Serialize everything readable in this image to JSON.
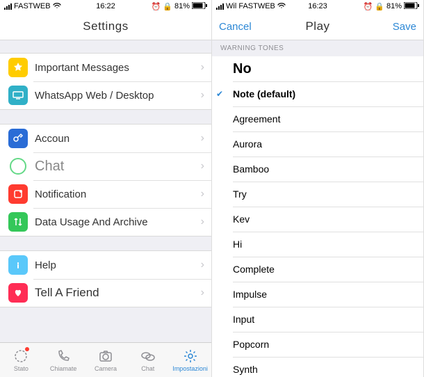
{
  "left": {
    "status": {
      "carrier": "FASTWEB",
      "time": "16:22",
      "battery": "81%"
    },
    "title": "Settings",
    "groups": [
      {
        "rows": [
          {
            "key": "important",
            "label": "Important Messages",
            "color": "#ffcc00"
          },
          {
            "key": "waweb",
            "label": "WhatsApp Web / Desktop",
            "color": "#30b0c7"
          }
        ]
      },
      {
        "rows": [
          {
            "key": "account",
            "label": "Accoun",
            "color": "#2a6cd6"
          },
          {
            "key": "chat",
            "label": "Chat",
            "color": "#64d987"
          },
          {
            "key": "notification",
            "label": "Notification",
            "color": "#ff3b30"
          },
          {
            "key": "data",
            "label": "Data Usage And Archive",
            "color": "#34c759"
          }
        ]
      },
      {
        "rows": [
          {
            "key": "help",
            "label": "Help",
            "color": "#5ac8fa"
          },
          {
            "key": "tell",
            "label": "Tell A Friend",
            "color": "#ff2d55"
          }
        ]
      }
    ],
    "tabs": [
      {
        "key": "stato",
        "label": "Stato"
      },
      {
        "key": "chiamate",
        "label": "Chiamate"
      },
      {
        "key": "camera",
        "label": "Camera"
      },
      {
        "key": "chat",
        "label": "Chat"
      },
      {
        "key": "impostazioni",
        "label": "Impostazioni"
      }
    ]
  },
  "right": {
    "status": {
      "carrier": "Wil FASTWEB",
      "time": "16:23",
      "battery": "81%"
    },
    "cancel": "Cancel",
    "title": "Play",
    "save": "Save",
    "section_header": "WARNING TONES",
    "tones": [
      {
        "key": "no",
        "label": "No",
        "big": true
      },
      {
        "key": "note",
        "label": "Note (default)",
        "selected": true
      },
      {
        "key": "agreement",
        "label": "Agreement"
      },
      {
        "key": "aurora",
        "label": "Aurora"
      },
      {
        "key": "bamboo",
        "label": "Bamboo"
      },
      {
        "key": "try",
        "label": "Try"
      },
      {
        "key": "kev",
        "label": "Kev"
      },
      {
        "key": "hi",
        "label": "Hi"
      },
      {
        "key": "complete",
        "label": "Complete"
      },
      {
        "key": "impulse",
        "label": "Impulse"
      },
      {
        "key": "input",
        "label": "Input"
      },
      {
        "key": "popcorn",
        "label": "Popcorn"
      },
      {
        "key": "synth",
        "label": "Synth"
      }
    ]
  }
}
